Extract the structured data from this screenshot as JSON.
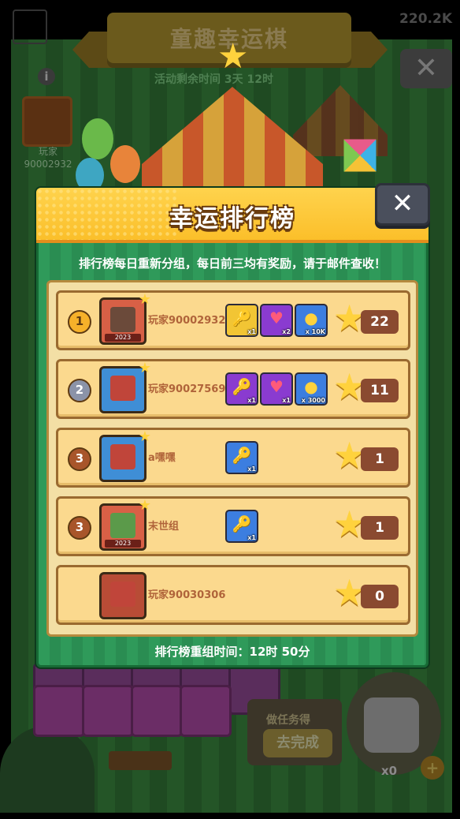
{
  "background": {
    "title": "童趣幸运棋",
    "currency": "220.2K",
    "event_timer": "活动剩余时间 3天 12时",
    "player_label": "玩家90002932",
    "task_label": "做任务得",
    "task_button": "去完成",
    "dice_count": "x0"
  },
  "modal": {
    "title": "幸运排行榜",
    "close_label": "✕",
    "subtitle": "排行榜每日重新分组，每日前三均有奖励，请于邮件查收！",
    "footer": "排行榜重组时间：12时 50分"
  },
  "rows": [
    {
      "rank": "1",
      "name": "玩家90002932",
      "score": "22",
      "avatar_tag": "2023",
      "rewards": [
        {
          "icon": "gold-key-icon",
          "glyph": "🔑",
          "qty": "x1"
        },
        {
          "icon": "heart-icon",
          "glyph": "♥",
          "qty": "x2"
        },
        {
          "icon": "coin-icon",
          "glyph": "●",
          "qty": "x 10K"
        }
      ]
    },
    {
      "rank": "2",
      "name": "玩家90027569",
      "score": "11",
      "avatar_tag": "",
      "rewards": [
        {
          "icon": "purple-key-icon",
          "glyph": "🔑",
          "qty": "x1"
        },
        {
          "icon": "heart-icon",
          "glyph": "♥",
          "qty": "x1"
        },
        {
          "icon": "coin-icon",
          "glyph": "●",
          "qty": "x 3000"
        }
      ]
    },
    {
      "rank": "3",
      "name": "a嘿嘿",
      "score": "1",
      "avatar_tag": "",
      "rewards": [
        {
          "icon": "blue-key-icon",
          "glyph": "🔑",
          "qty": "x1"
        }
      ]
    },
    {
      "rank": "3",
      "name": "末世组",
      "score": "1",
      "avatar_tag": "2023",
      "rewards": [
        {
          "icon": "blue-key-icon",
          "glyph": "🔑",
          "qty": "x1"
        }
      ]
    },
    {
      "rank": "",
      "name": "玩家90030306",
      "score": "0",
      "avatar_tag": "",
      "rewards": []
    }
  ]
}
